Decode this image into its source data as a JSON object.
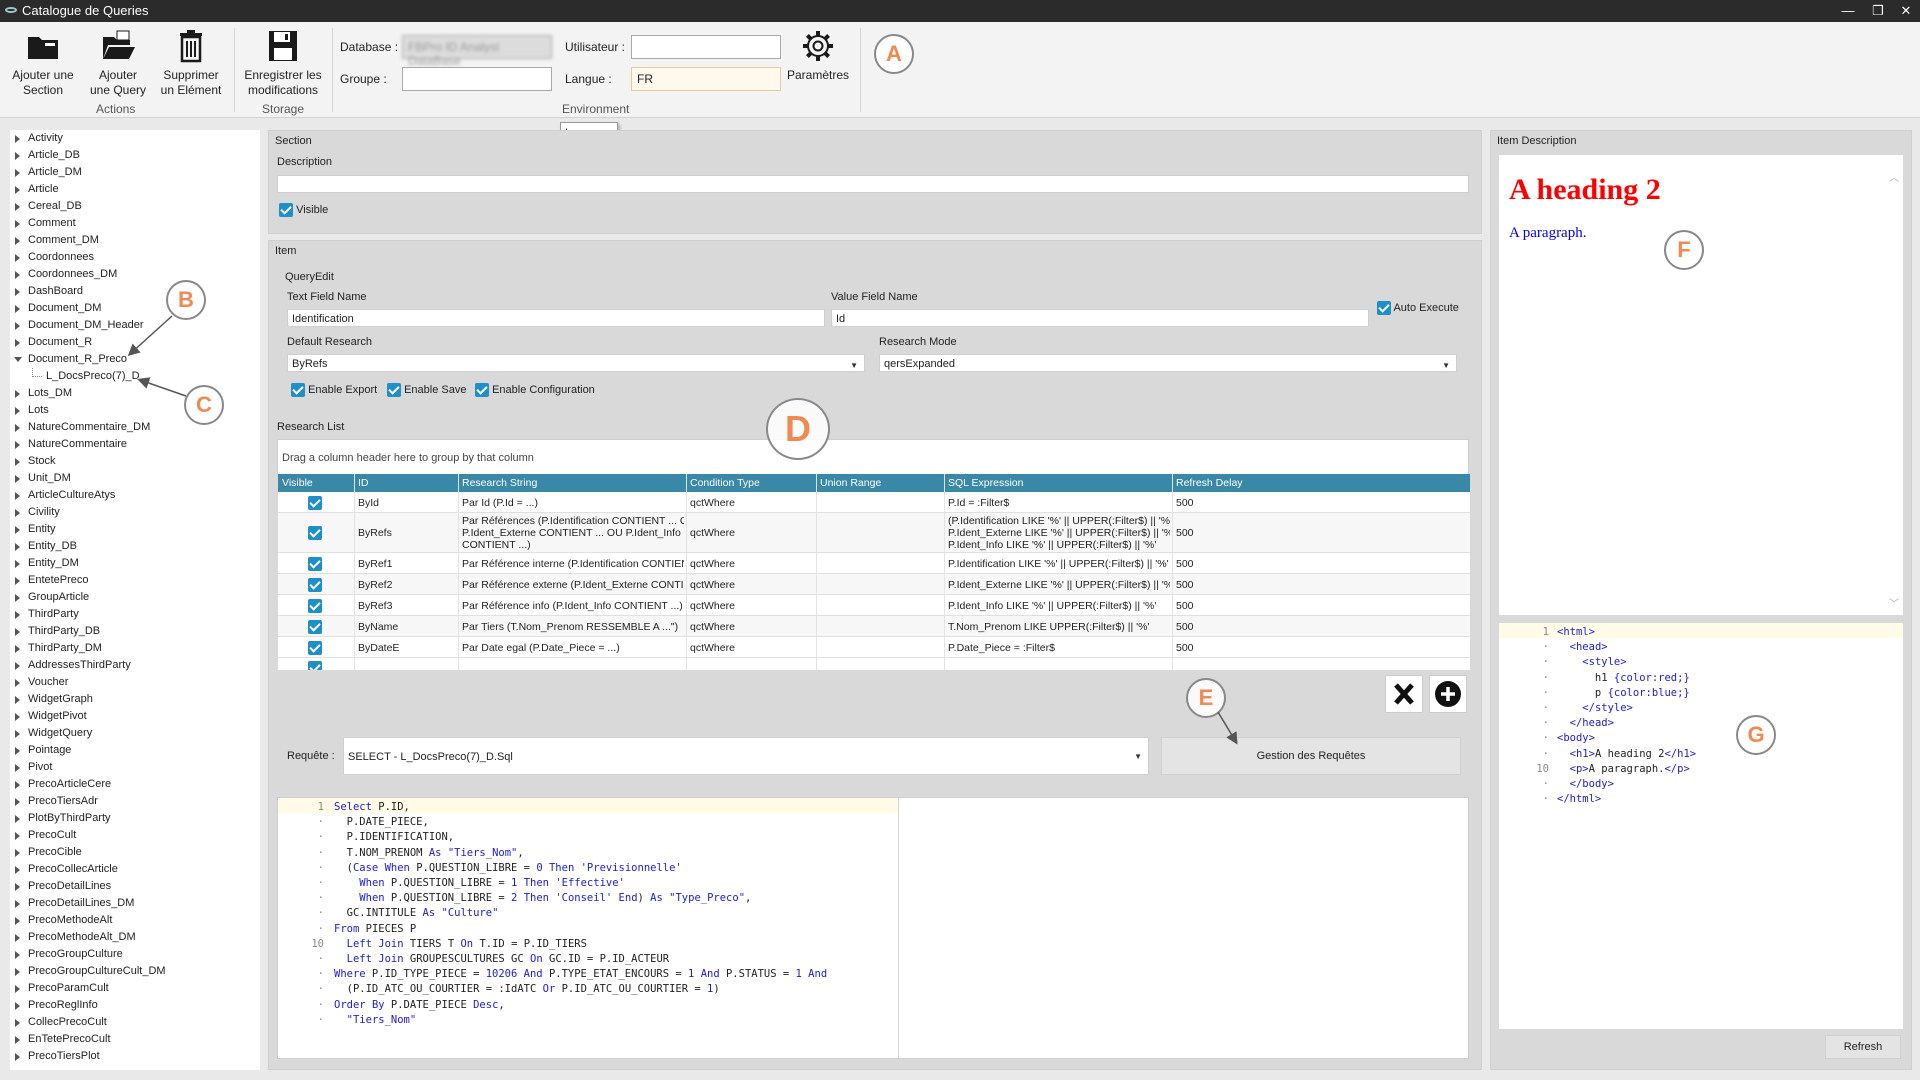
{
  "window": {
    "title": "Catalogue de Queries"
  },
  "ribbon": {
    "actions": [
      {
        "l1": "Ajouter une",
        "l2": "Section",
        "icon": "folder-icon"
      },
      {
        "l1": "Ajouter",
        "l2": "une Query",
        "icon": "open-folder-icon"
      },
      {
        "l1": "Supprimer",
        "l2": "un Elément",
        "icon": "trash-icon"
      }
    ],
    "actions_group": "Actions",
    "save": {
      "l1": "Enregistrer les",
      "l2": "modifications",
      "icon": "floppy-disk-icon"
    },
    "storage_group": "Storage",
    "database_label": "Database :",
    "database_value": "FBPro ID Analyst DataBase",
    "groupe_label": "Groupe :",
    "groupe_value": "",
    "utilisateur_label": "Utilisateur :",
    "utilisateur_value": "",
    "langue_label": "Langue :",
    "langue_value": "FR",
    "params_label": "Paramètres",
    "params_icon": "gear-icon",
    "environment_group": "Environment",
    "tooltip": "Langue :"
  },
  "callouts": [
    "A",
    "B",
    "C",
    "D",
    "E",
    "F",
    "G"
  ],
  "tree": {
    "items": [
      "Activity",
      "Article_DB",
      "Article_DM",
      "Article",
      "Cereal_DB",
      "Comment",
      "Comment_DM",
      "Coordonnees",
      "Coordonnees_DM",
      "DashBoard",
      "Document_DM",
      "Document_DM_Header",
      "Document_R",
      "Document_R_Preco"
    ],
    "child": "L_DocsPreco(7)_D",
    "items2": [
      "Lots_DM",
      "Lots",
      "NatureCommentaire_DM",
      "NatureCommentaire",
      "Stock",
      "Unit_DM",
      "ArticleCultureAtys",
      "Civility",
      "Entity",
      "Entity_DB",
      "Entity_DM",
      "EntetePreco",
      "GroupArticle",
      "ThirdParty",
      "ThirdParty_DB",
      "ThirdParty_DM",
      "AddressesThirdParty",
      "Voucher",
      "WidgetGraph",
      "WidgetPivot",
      "WidgetQuery",
      "Pointage",
      "Pivot",
      "PrecoArticleCere",
      "PrecoTiersAdr",
      "PlotByThirdParty",
      "PrecoCult",
      "PrecoCible",
      "PrecoCollecArticle",
      "PrecoDetailLines",
      "PrecoDetailLines_DM",
      "PrecoMethodeAlt",
      "PrecoMethodeAlt_DM",
      "PrecoGroupCulture",
      "PrecoGroupCultureCult_DM",
      "PrecoParamCult",
      "PrecoReglInfo",
      "CollecPrecoCult",
      "EnTetePrecoCult",
      "PrecoTiersPlot"
    ]
  },
  "section": {
    "title": "Section",
    "description_label": "Description",
    "description_value": "",
    "visible_label": "Visible"
  },
  "item": {
    "title": "Item",
    "queryedit_label": "QueryEdit",
    "text_field_label": "Text Field Name",
    "text_field_value": "Identification",
    "value_field_label": "Value Field Name",
    "value_field_value": "Id",
    "auto_execute_label": "Auto Execute",
    "default_research_label": "Default Research",
    "default_research_value": "ByRefs",
    "research_mode_label": "Research Mode",
    "research_mode_value": "qersExpanded",
    "enable_export": "Enable Export",
    "enable_save": "Enable Save",
    "enable_config": "Enable Configuration",
    "research_list_label": "Research List",
    "group_hint": "Drag a column header here to group by that column",
    "columns": [
      "Visible",
      "ID",
      "Research String",
      "Condition Type",
      "Union Range",
      "SQL Expression",
      "Refresh Delay"
    ],
    "rows": [
      {
        "id": "ById",
        "rs": "Par Id (P.Id = ...)",
        "ct": "qctWhere",
        "ur": "",
        "sql": "P.Id = :Filter$",
        "rd": "500"
      },
      {
        "id": "ByRefs",
        "rs": "Par Références (P.Identification CONTIENT ... OU\nP.Ident_Externe CONTIENT ... OU P.Ident_Info\nCONTIENT ...)",
        "ct": "qctWhere",
        "ur": "",
        "sql": "(P.Identification LIKE '%' || UPPER(:Filter$) || '%' OR\nP.Ident_Externe LIKE '%' || UPPER(:Filter$) || '%' OR\nP.Ident_Info LIKE '%' || UPPER(:Filter$) || '%'",
        "rd": "500"
      },
      {
        "id": "ByRef1",
        "rs": "Par Référence interne (P.Identification CONTIENT ...)",
        "ct": "qctWhere",
        "ur": "",
        "sql": "P.Identification LIKE '%' || UPPER(:Filter$) || '%'",
        "rd": "500"
      },
      {
        "id": "ByRef2",
        "rs": "Par Référence externe (P.Ident_Externe CONTIENT ...)",
        "ct": "qctWhere",
        "ur": "",
        "sql": "P.Ident_Externe LIKE '%' || UPPER(:Filter$) || '%'",
        "rd": "500"
      },
      {
        "id": "ByRef3",
        "rs": "Par Référence info (P.Ident_Info CONTIENT ...)",
        "ct": "qctWhere",
        "ur": "",
        "sql": "P.Ident_Info LIKE '%' || UPPER(:Filter$) || '%'",
        "rd": "500"
      },
      {
        "id": "ByName",
        "rs": "Par Tiers (T.Nom_Prenom RESSEMBLE A ...\")",
        "ct": "qctWhere",
        "ur": "",
        "sql": "T.Nom_Prenom LIKE UPPER(:Filter$) || '%'",
        "rd": "500"
      },
      {
        "id": "ByDateE",
        "rs": "Par Date egal (P.Date_Piece = ...)",
        "ct": "qctWhere",
        "ur": "",
        "sql": "P.Date_Piece = :Filter$",
        "rd": "500"
      }
    ],
    "delete_icon": "x-icon",
    "add_icon": "plus-circle-icon",
    "requete_label": "Requête :",
    "requete_value": "SELECT - L_DocsPreco(7)_D.Sql",
    "gestion_button": "Gestion des Requêtes"
  },
  "sql_lines": [
    "Select P.ID,",
    "  P.DATE_PIECE,",
    "  P.IDENTIFICATION,",
    "  T.NOM_PRENOM As \"Tiers_Nom\",",
    "  (Case When P.QUESTION_LIBRE = 0 Then 'Previsionnelle'",
    "    When P.QUESTION_LIBRE = 1 Then 'Effective'",
    "    When P.QUESTION_LIBRE = 2 Then 'Conseil' End) As \"Type_Preco\",",
    "  GC.INTITULE As \"Culture\"",
    "From PIECES P",
    "  Left Join TIERS T On T.ID = P.ID_TIERS",
    "  Left Join GROUPESCULTURES GC On GC.ID = P.ID_ACTEUR",
    "Where P.ID_TYPE_PIECE = 10206 And P.TYPE_ETAT_ENCOURS = 1 And P.STATUS = 1 And",
    "  (P.ID_ATC_OU_COURTIER = :IdATC Or P.ID_ATC_OU_COURTIER = 1)",
    "Order By P.DATE_PIECE Desc,",
    "  \"Tiers_Nom\""
  ],
  "description": {
    "title": "Item Description",
    "heading": "A heading 2",
    "paragraph": "A paragraph.",
    "heading_color": "#ff0000",
    "paragraph_color": "#0000ff",
    "html_lines": [
      "<html>",
      "  <head>",
      "    <style>",
      "      h1 {color:red;}",
      "      p {color:blue;}",
      "    </style>",
      "  </head>",
      "<body>",
      "  <h1>A heading 2</h1>",
      "  <p>A paragraph.</p>",
      "  </body>",
      "</html>"
    ],
    "refresh_button": "Refresh"
  }
}
